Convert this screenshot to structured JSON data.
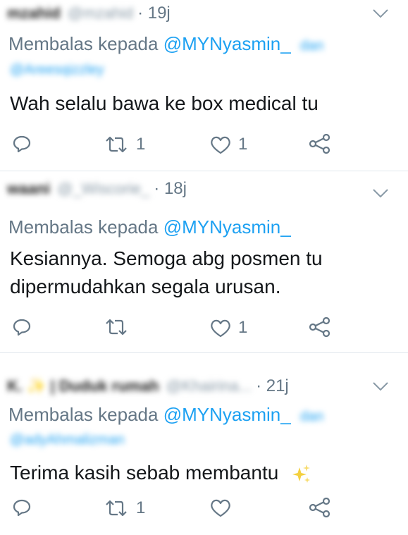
{
  "tweets": [
    {
      "display_name": "mzahid",
      "handle": "@mzahid",
      "time": "· 19j",
      "reply_prefix": "Membalas kepada",
      "reply_mention": "@MYNyasmin_",
      "reply_extra": "dan",
      "reply_line2": "@Areesqizzley",
      "text": [
        "Wah selalu bawa ke box medical tu"
      ],
      "retweets": "1",
      "likes": "1"
    },
    {
      "display_name": "waani",
      "handle": "@_Wiscorie_",
      "time": "· 18j",
      "reply_prefix": "Membalas kepada",
      "reply_mention": "@MYNyasmin_",
      "text": [
        "Kesiannya. Semoga abg posmen tu",
        "dipermudahkan segala urusan."
      ],
      "retweets": "",
      "likes": "1"
    },
    {
      "display_name": "K. ✨ | Duduk rumah",
      "handle": "@Khairina...",
      "time": "· 21j",
      "reply_prefix": "Membalas kepada",
      "reply_mention": "@MYNyasmin_",
      "reply_extra": "dan",
      "reply_line2": "@adyAhmalizman",
      "text": [
        "Terima kasih sebab membantu"
      ],
      "retweets": "1",
      "likes": ""
    }
  ],
  "icons": [
    "reply-icon",
    "retweet-icon",
    "like-icon",
    "share-icon",
    "chevron-down-icon",
    "sparkles-icon"
  ],
  "colors": {
    "accent": "#1da1f2",
    "muted": "#657786",
    "sparkle": "#f4d03f"
  }
}
